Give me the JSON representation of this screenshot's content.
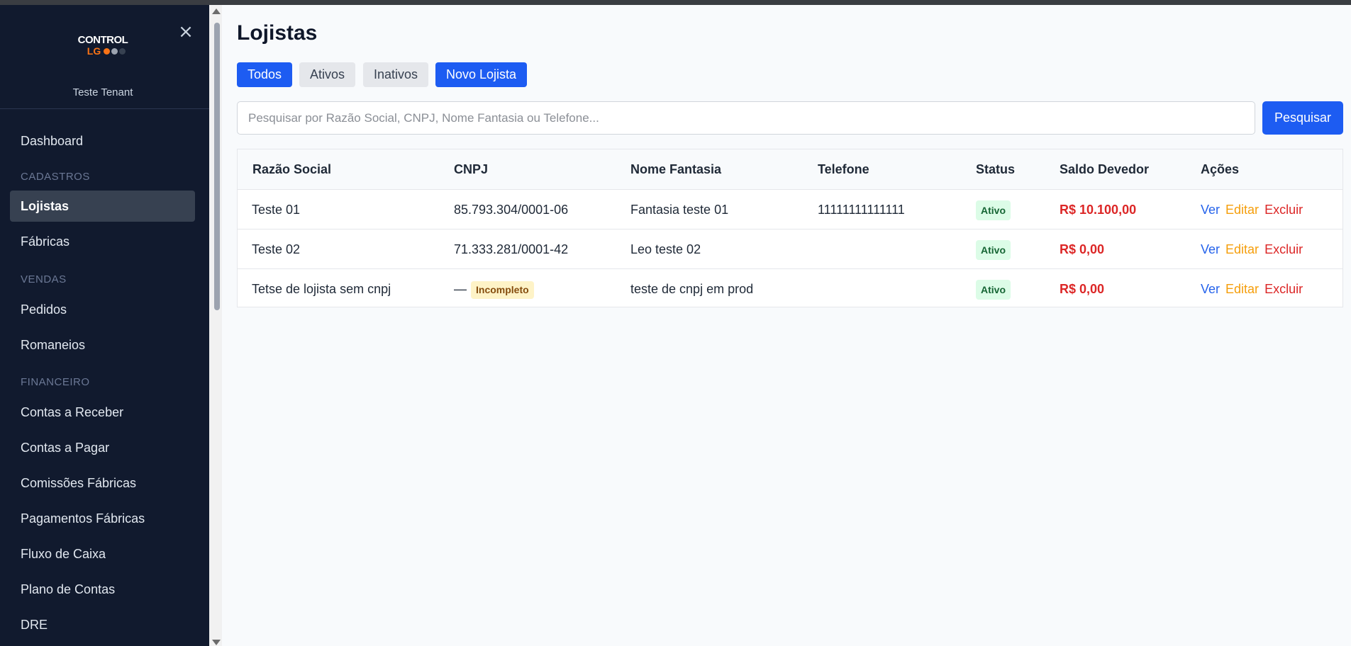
{
  "sidebar": {
    "logo": {
      "line1": "CONTROL",
      "line2": "LG"
    },
    "tenant": "Teste Tenant",
    "close_icon": "×",
    "items": {
      "dashboard": "Dashboard",
      "lojistas": "Lojistas",
      "fabricas": "Fábricas",
      "pedidos": "Pedidos",
      "romaneios": "Romaneios",
      "contas_receber": "Contas a Receber",
      "contas_pagar": "Contas a Pagar",
      "comissoes_fabricas": "Comissões Fábricas",
      "pagamentos_fabricas": "Pagamentos Fábricas",
      "fluxo_caixa": "Fluxo de Caixa",
      "plano_contas": "Plano de Contas",
      "dre": "DRE"
    },
    "sections": {
      "cadastros": "CADASTROS",
      "vendas": "VENDAS",
      "financeiro": "FINANCEIRO"
    }
  },
  "main": {
    "title": "Lojistas",
    "filters": {
      "todos": "Todos",
      "ativos": "Ativos",
      "inativos": "Inativos",
      "novo": "Novo Lojista"
    },
    "search": {
      "placeholder": "Pesquisar por Razão Social, CNPJ, Nome Fantasia ou Telefone...",
      "button": "Pesquisar"
    },
    "table": {
      "headers": {
        "razao": "Razão Social",
        "cnpj": "CNPJ",
        "fantasia": "Nome Fantasia",
        "telefone": "Telefone",
        "status": "Status",
        "saldo": "Saldo Devedor",
        "acoes": "Ações"
      },
      "actions": {
        "ver": "Ver",
        "editar": "Editar",
        "excluir": "Excluir"
      },
      "rows": [
        {
          "razao": "Teste 01",
          "cnpj": "85.793.304/0001-06",
          "fantasia": "Fantasia teste 01",
          "telefone": "11111111111111",
          "status": "Ativo",
          "saldo": "R$ 10.100,00"
        },
        {
          "razao": "Teste 02",
          "cnpj": "71.333.281/0001-42",
          "fantasia": "Leo teste 02",
          "telefone": "",
          "status": "Ativo",
          "saldo": "R$ 0,00"
        },
        {
          "razao": "Tetse de lojista sem cnpj",
          "cnpj": "—",
          "cnpj_badge": "Incompleto",
          "fantasia": "teste de cnpj em prod",
          "telefone": "",
          "status": "Ativo",
          "saldo": "R$ 0,00"
        }
      ]
    }
  },
  "colors": {
    "sidebar_bg": "#111a2e",
    "primary": "#1d5cf2",
    "danger": "#dc2626",
    "warning": "#f59e0b",
    "success_bg": "#dcfce7"
  }
}
